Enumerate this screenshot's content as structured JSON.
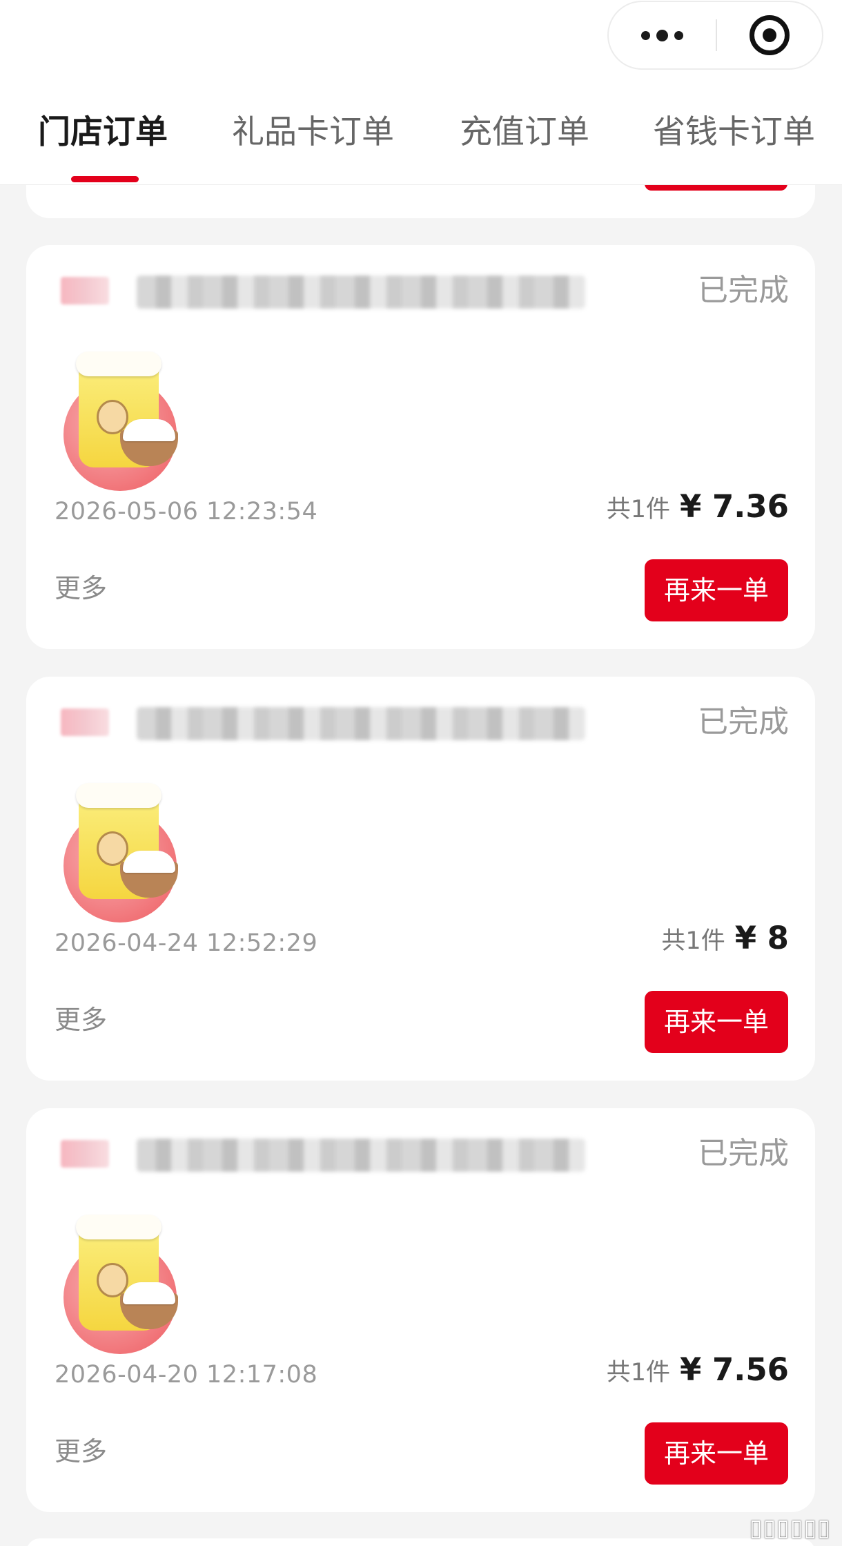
{
  "header": {
    "capsule": {
      "menu_icon": "more-dots-icon",
      "close_icon": "target-circle-icon"
    }
  },
  "tabs": [
    {
      "label": "门店订单",
      "active": true
    },
    {
      "label": "礼品卡订单",
      "active": false
    },
    {
      "label": "充值订单",
      "active": false
    },
    {
      "label": "省钱卡订单",
      "active": false
    }
  ],
  "orders": [
    {
      "status": "已完成",
      "datetime": "2026-05-06 12:23:54",
      "count": "共1件",
      "price": "¥ 7.36",
      "more": "更多",
      "reorder": "再来一单"
    },
    {
      "status": "已完成",
      "datetime": "2026-04-24 12:52:29",
      "count": "共1件",
      "price": "¥ 8",
      "more": "更多",
      "reorder": "再来一单"
    },
    {
      "status": "已完成",
      "datetime": "2026-04-20 12:17:08",
      "count": "共1件",
      "price": "¥ 7.56",
      "more": "更多",
      "reorder": "再来一单"
    }
  ],
  "colors": {
    "accent": "#e3001b",
    "background": "#f4f4f4",
    "card": "#ffffff"
  }
}
